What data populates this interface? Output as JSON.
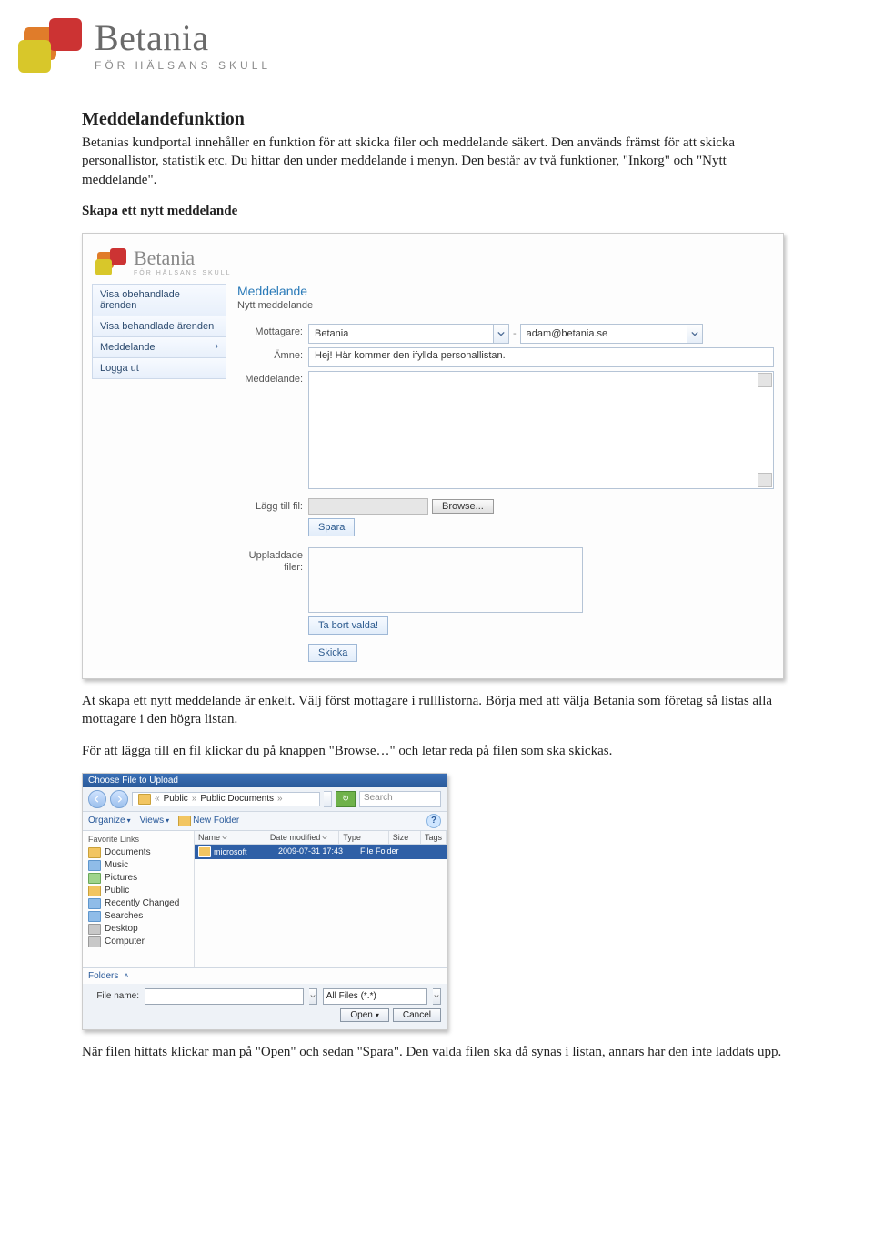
{
  "header": {
    "brand_name": "Betania",
    "brand_tagline": "FÖR HÄLSANS SKULL"
  },
  "doc": {
    "title": "Meddelandefunktion",
    "intro": "Betanias kundportal innehåller en funktion för att skicka filer och meddelande säkert. Den används främst för att skicka personallistor, statistik etc. Du hittar den under meddelande i menyn. Den består av två funktioner, \"Inkorg\" och \"Nytt meddelande\".",
    "create_heading": "Skapa ett nytt meddelande",
    "after_shot1_p1": "At skapa ett nytt meddelande är enkelt. Välj först mottagare i rulllistorna. Börja med att välja Betania som företag så listas alla mottagare i den högra listan.",
    "after_shot1_p2": "För att lägga till en fil klickar du på knappen \"Browse…\" och letar reda på filen som ska skickas.",
    "after_shot2": "När filen hittats klickar man på \"Open\" och sedan \"Spara\". Den valda filen ska då synas i listan, annars har den inte laddats upp."
  },
  "app": {
    "brand_name": "Betania",
    "brand_tagline": "FÖR HÄLSANS SKULL",
    "side_items": [
      "Visa obehandlade ärenden",
      "Visa behandlade ärenden",
      "Meddelande",
      "Logga ut"
    ],
    "main_title": "Meddelande",
    "main_sub": "Nytt meddelande",
    "labels": {
      "recipient": "Mottagare:",
      "subject": "Ämne:",
      "message": "Meddelande:",
      "addfile": "Lägg till fil:",
      "uploaded": "Uppladdade filer:"
    },
    "recipient_company": "Betania",
    "recipient_email": "adam@betania.se",
    "subject_value": "Hej! Här kommer den ifyllda personallistan.",
    "buttons": {
      "browse": "Browse...",
      "save": "Spara",
      "remove": "Ta bort valda!",
      "send": "Skicka"
    }
  },
  "dialog": {
    "title": "Choose File to Upload",
    "crumb_root": "Public",
    "crumb_leaf": "Public Documents",
    "search_placeholder": "Search",
    "toolbar": {
      "organize": "Organize",
      "views": "Views",
      "newfolder": "New Folder"
    },
    "fav_header": "Favorite Links",
    "fav_items": [
      "Documents",
      "Music",
      "Pictures",
      "Public",
      "Recently Changed",
      "Searches",
      "Desktop",
      "Computer"
    ],
    "folders_label": "Folders",
    "columns": [
      "Name",
      "Date modified",
      "Type",
      "Size",
      "Tags"
    ],
    "row": {
      "name": "microsoft",
      "date": "2009-07-31 17:43",
      "type": "File Folder"
    },
    "filename_label": "File name:",
    "filter": "All Files (*.*)",
    "open": "Open",
    "cancel": "Cancel"
  }
}
